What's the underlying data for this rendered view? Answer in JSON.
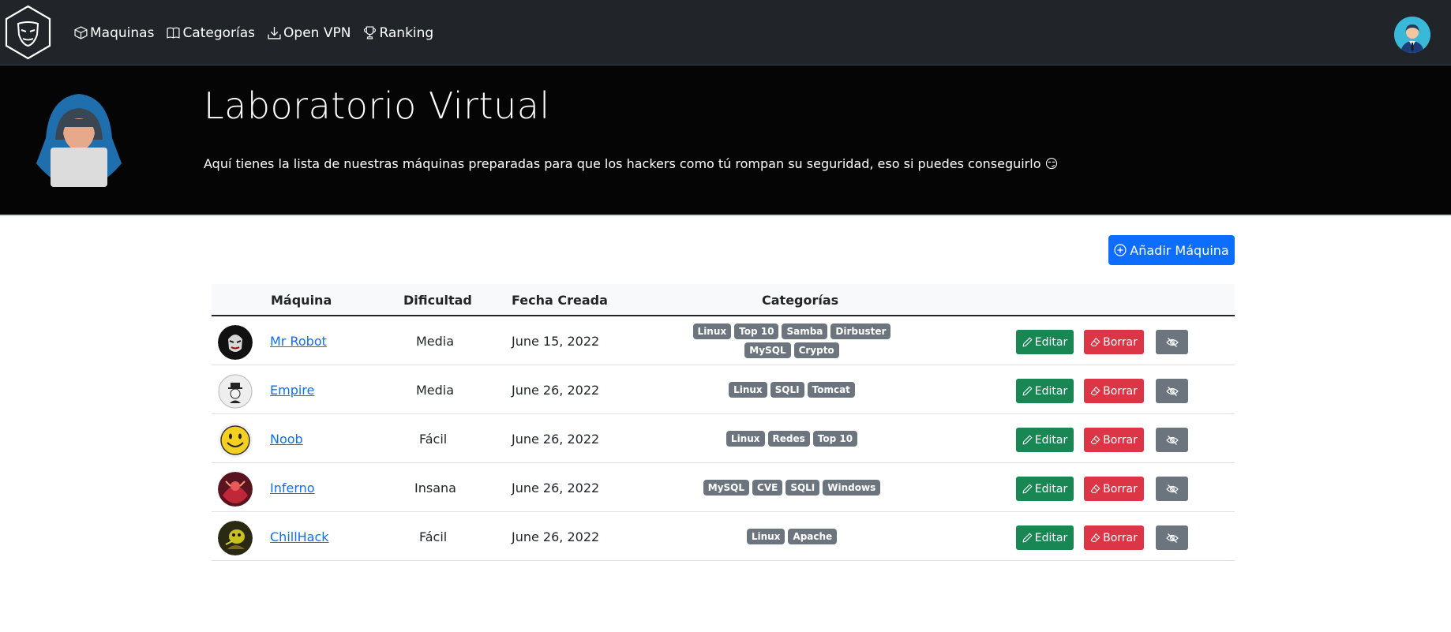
{
  "nav": {
    "items": [
      {
        "label": "Maquinas",
        "icon": "box-icon"
      },
      {
        "label": "Categorías",
        "icon": "book-icon"
      },
      {
        "label": "Open VPN",
        "icon": "download-icon"
      },
      {
        "label": "Ranking",
        "icon": "trophy-icon"
      }
    ]
  },
  "hero": {
    "title": "Laboratorio Virtual",
    "text": "Aquí tienes la lista de nuestras máquinas preparadas para que los hackers como tú rompan su seguridad, eso si puedes conseguirlo 😏"
  },
  "toolbar": {
    "add_label": "Añadir Máquina"
  },
  "table": {
    "headers": {
      "machine": "Máquina",
      "difficulty": "Dificultad",
      "date": "Fecha Creada",
      "categories": "Categorías"
    },
    "rows": [
      {
        "name": "Mr Robot",
        "difficulty": "Media",
        "date": "June 15, 2022",
        "categories": [
          "Linux",
          "Top 10",
          "Samba",
          "Dirbuster",
          "MySQL",
          "Crypto"
        ],
        "thumb_color": "#1a1a1a"
      },
      {
        "name": "Empire",
        "difficulty": "Media",
        "date": "June 26, 2022",
        "categories": [
          "Linux",
          "SQLI",
          "Tomcat"
        ],
        "thumb_color": "#eeeeee"
      },
      {
        "name": "Noob",
        "difficulty": "Fácil",
        "date": "June 26, 2022",
        "categories": [
          "Linux",
          "Redes",
          "Top 10"
        ],
        "thumb_color": "#f6d01f"
      },
      {
        "name": "Inferno",
        "difficulty": "Insana",
        "date": "June 26, 2022",
        "categories": [
          "MySQL",
          "CVE",
          "SQLI",
          "Windows"
        ],
        "thumb_color": "#8b1e2b"
      },
      {
        "name": "ChillHack",
        "difficulty": "Fácil",
        "date": "June 26, 2022",
        "categories": [
          "Linux",
          "Apache"
        ],
        "thumb_color": "#3a3a1a"
      }
    ],
    "actions": {
      "edit": "Editar",
      "delete": "Borrar"
    }
  },
  "colors": {
    "primary": "#0d6efd",
    "success": "#198754",
    "danger": "#dc3545",
    "secondary": "#6c757d",
    "navbar": "#212529"
  }
}
